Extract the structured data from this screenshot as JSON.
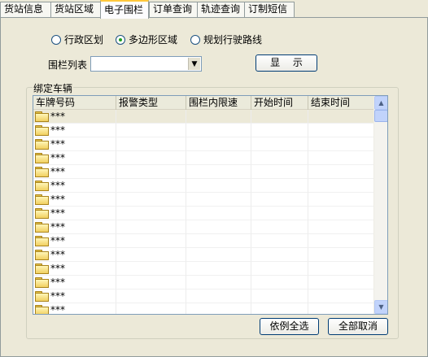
{
  "tabs": [
    {
      "label": "货站信息",
      "active": false
    },
    {
      "label": "货站区域",
      "active": false
    },
    {
      "label": "电子围栏",
      "active": true
    },
    {
      "label": "订单查询",
      "active": false
    },
    {
      "label": "轨迹查询",
      "active": false
    },
    {
      "label": "订制短信",
      "active": false
    }
  ],
  "radios": [
    {
      "label": "行政区划",
      "checked": false
    },
    {
      "label": "多边形区域",
      "checked": true
    },
    {
      "label": "规划行驶路线",
      "checked": false
    }
  ],
  "fence": {
    "label": "围栏列表",
    "selected": "",
    "show_label": "显 示"
  },
  "vehicles": {
    "group_title": "绑定车辆",
    "columns": [
      "车牌号码",
      "报警类型",
      "围栏内限速",
      "开始时间",
      "结束时间"
    ],
    "rows": [
      {
        "plate": "***"
      },
      {
        "plate": "***"
      },
      {
        "plate": "***"
      },
      {
        "plate": "***"
      },
      {
        "plate": "***"
      },
      {
        "plate": "***"
      },
      {
        "plate": "***"
      },
      {
        "plate": "***"
      },
      {
        "plate": "***"
      },
      {
        "plate": "***"
      },
      {
        "plate": "***"
      },
      {
        "plate": "***"
      },
      {
        "plate": "***"
      },
      {
        "plate": "***"
      },
      {
        "plate": "***"
      }
    ]
  },
  "buttons": {
    "select_all": "依例全选",
    "cancel_all": "全部取消"
  }
}
